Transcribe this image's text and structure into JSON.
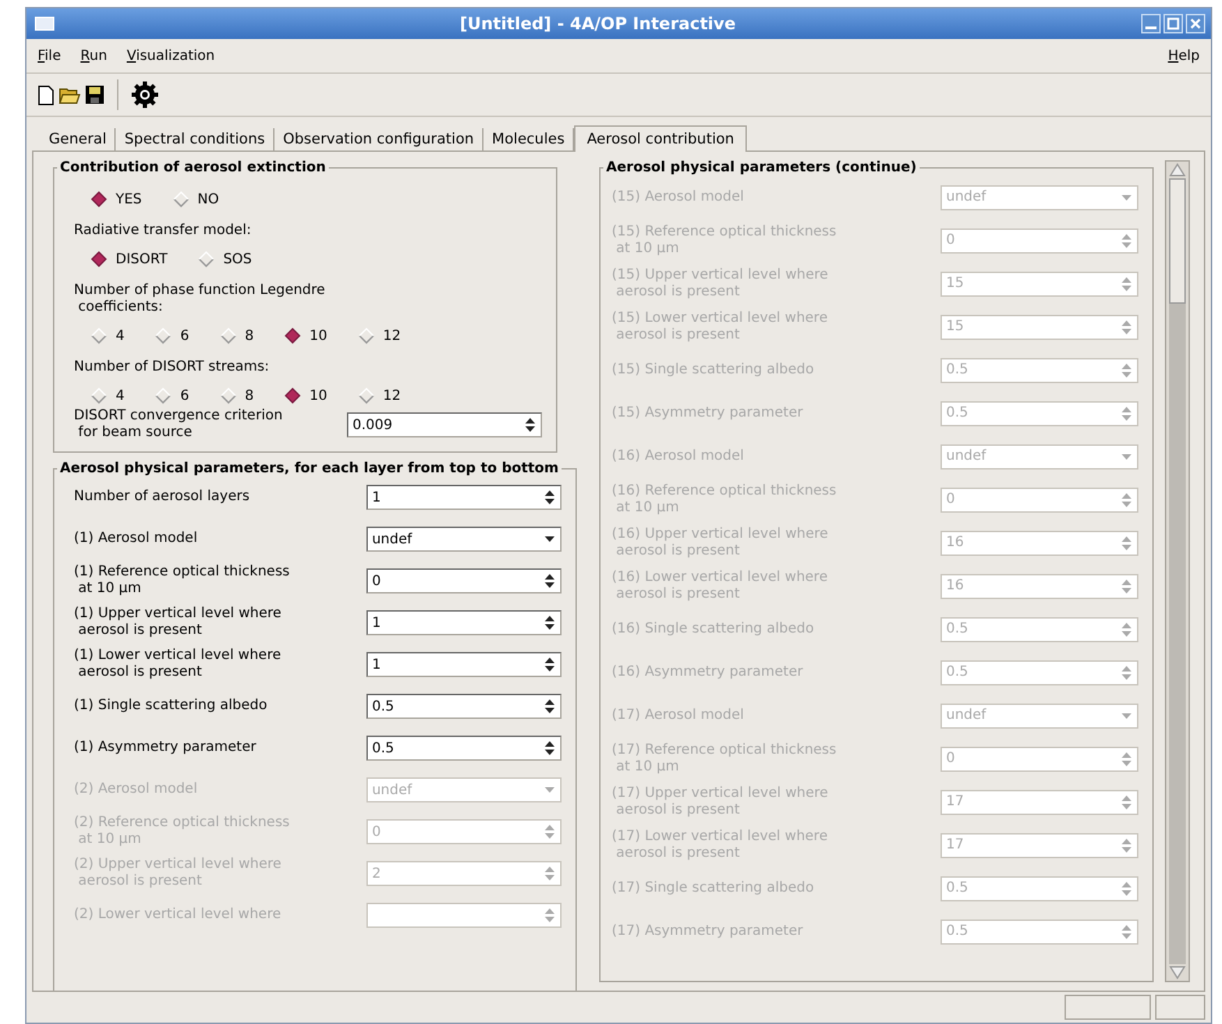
{
  "window": {
    "title": "[Untitled] - 4A/OP Interactive"
  },
  "menu": [
    {
      "key": "F",
      "rest": "ile"
    },
    {
      "key": "R",
      "rest": "un"
    },
    {
      "key": "V",
      "rest": "isualization"
    }
  ],
  "help_menu": {
    "key": "H",
    "rest": "elp"
  },
  "tabs": [
    {
      "label": "General",
      "selected": false
    },
    {
      "label": "Spectral conditions",
      "selected": false
    },
    {
      "label": "Observation configuration",
      "selected": false
    },
    {
      "label": "Molecules",
      "selected": false
    },
    {
      "label": "Aerosol contribution",
      "selected": true
    }
  ],
  "extinction": {
    "title": "Contribution of aerosol extinction",
    "sections": [
      {
        "options": [
          {
            "label": "YES",
            "selected": true
          },
          {
            "label": "NO",
            "selected": false
          }
        ]
      },
      {
        "label": "Radiative transfer model:",
        "options": [
          {
            "label": "DISORT",
            "selected": true
          },
          {
            "label": "SOS",
            "selected": false
          }
        ]
      },
      {
        "label": "Number of phase function Legendre\n coefficients:",
        "options": [
          {
            "label": "4",
            "selected": false
          },
          {
            "label": "6",
            "selected": false
          },
          {
            "label": "8",
            "selected": false
          },
          {
            "label": "10",
            "selected": true
          },
          {
            "label": "12",
            "selected": false
          }
        ]
      },
      {
        "label": "Number of DISORT streams:",
        "options": [
          {
            "label": "4",
            "selected": false
          },
          {
            "label": "6",
            "selected": false
          },
          {
            "label": "8",
            "selected": false
          },
          {
            "label": "10",
            "selected": true
          },
          {
            "label": "12",
            "selected": false
          }
        ]
      }
    ],
    "convergence": {
      "label": "DISORT convergence criterion\n for beam source",
      "value": "0.009",
      "kind": "spin",
      "disabled": false
    }
  },
  "layers": {
    "title": "Aerosol physical parameters, for each layer from top to bottom",
    "rows": [
      {
        "label": "Number of aerosol layers",
        "value": "1",
        "kind": "spin",
        "disabled": false
      },
      {
        "label": "(1) Aerosol model",
        "value": "undef",
        "kind": "combo",
        "disabled": false
      },
      {
        "label": "(1) Reference optical thickness\n at 10 µm",
        "value": "0",
        "kind": "spin",
        "disabled": false
      },
      {
        "label": "(1) Upper vertical level where\n aerosol is present",
        "value": "1",
        "kind": "spin",
        "disabled": false
      },
      {
        "label": "(1) Lower vertical level where\n aerosol is present",
        "value": "1",
        "kind": "spin",
        "disabled": false
      },
      {
        "label": "(1) Single scattering albedo",
        "value": "0.5",
        "kind": "spin",
        "disabled": false
      },
      {
        "label": "(1) Asymmetry parameter",
        "value": "0.5",
        "kind": "spin",
        "disabled": false
      },
      {
        "label": "(2) Aerosol model",
        "value": "undef",
        "kind": "combo",
        "disabled": true
      },
      {
        "label": "(2) Reference optical thickness\n at 10 µm",
        "value": "0",
        "kind": "spin",
        "disabled": true
      },
      {
        "label": "(2) Upper vertical level where\n aerosol is present",
        "value": "2",
        "kind": "spin",
        "disabled": true
      },
      {
        "label": "(2) Lower vertical level where",
        "kind": "spin",
        "disabled": true
      }
    ]
  },
  "continue": {
    "title": "Aerosol physical parameters (continue)",
    "rows": [
      {
        "label": "(15) Aerosol model",
        "value": "undef",
        "kind": "combo",
        "disabled": true
      },
      {
        "label": "(15) Reference optical thickness\n at 10 µm",
        "value": "0",
        "kind": "spin",
        "disabled": true
      },
      {
        "label": "(15) Upper vertical level where\n aerosol is present",
        "value": "15",
        "kind": "spin",
        "disabled": true
      },
      {
        "label": "(15) Lower vertical level where\n aerosol is present",
        "value": "15",
        "kind": "spin",
        "disabled": true
      },
      {
        "label": "(15) Single scattering albedo",
        "value": "0.5",
        "kind": "spin",
        "disabled": true
      },
      {
        "label": "(15) Asymmetry parameter",
        "value": "0.5",
        "kind": "spin",
        "disabled": true
      },
      {
        "label": "(16) Aerosol model",
        "value": "undef",
        "kind": "combo",
        "disabled": true
      },
      {
        "label": "(16) Reference optical thickness\n at 10 µm",
        "value": "0",
        "kind": "spin",
        "disabled": true
      },
      {
        "label": "(16) Upper vertical level where\n aerosol is present",
        "value": "16",
        "kind": "spin",
        "disabled": true
      },
      {
        "label": "(16) Lower vertical level where\n aerosol is present",
        "value": "16",
        "kind": "spin",
        "disabled": true
      },
      {
        "label": "(16) Single scattering albedo",
        "value": "0.5",
        "kind": "spin",
        "disabled": true
      },
      {
        "label": "(16) Asymmetry parameter",
        "value": "0.5",
        "kind": "spin",
        "disabled": true
      },
      {
        "label": "(17) Aerosol model",
        "value": "undef",
        "kind": "combo",
        "disabled": true
      },
      {
        "label": "(17) Reference optical thickness\n at 10 µm",
        "value": "0",
        "kind": "spin",
        "disabled": true
      },
      {
        "label": "(17) Upper vertical level where\n aerosol is present",
        "value": "17",
        "kind": "spin",
        "disabled": true
      },
      {
        "label": "(17) Lower vertical level where\n aerosol is present",
        "value": "17",
        "kind": "spin",
        "disabled": true
      },
      {
        "label": "(17) Single scattering albedo",
        "value": "0.5",
        "kind": "spin",
        "disabled": true
      },
      {
        "label": "(17) Asymmetry parameter",
        "value": "0.5",
        "kind": "spin",
        "disabled": true
      }
    ]
  }
}
